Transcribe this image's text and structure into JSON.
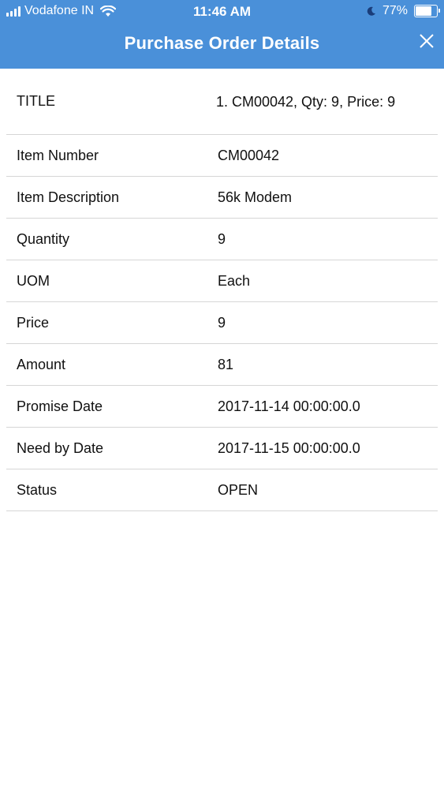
{
  "status_bar": {
    "carrier": "Vodafone IN",
    "time": "11:46 AM",
    "battery_percent": "77%",
    "battery_level": 0.77
  },
  "header": {
    "title": "Purchase Order Details"
  },
  "details": {
    "title": {
      "label": "TITLE",
      "item": "CM00042, Qty:  9, Price:  9"
    },
    "rows": [
      {
        "label": "Item Number",
        "value": "CM00042"
      },
      {
        "label": "Item Description",
        "value": "56k Modem"
      },
      {
        "label": "Quantity",
        "value": "9"
      },
      {
        "label": "UOM",
        "value": "Each"
      },
      {
        "label": "Price",
        "value": "9"
      },
      {
        "label": "Amount",
        "value": "81"
      },
      {
        "label": "Promise Date",
        "value": "2017-11-14 00:00:00.0"
      },
      {
        "label": "Need by Date",
        "value": "2017-11-15 00:00:00.0"
      },
      {
        "label": "Status",
        "value": "OPEN"
      }
    ]
  }
}
